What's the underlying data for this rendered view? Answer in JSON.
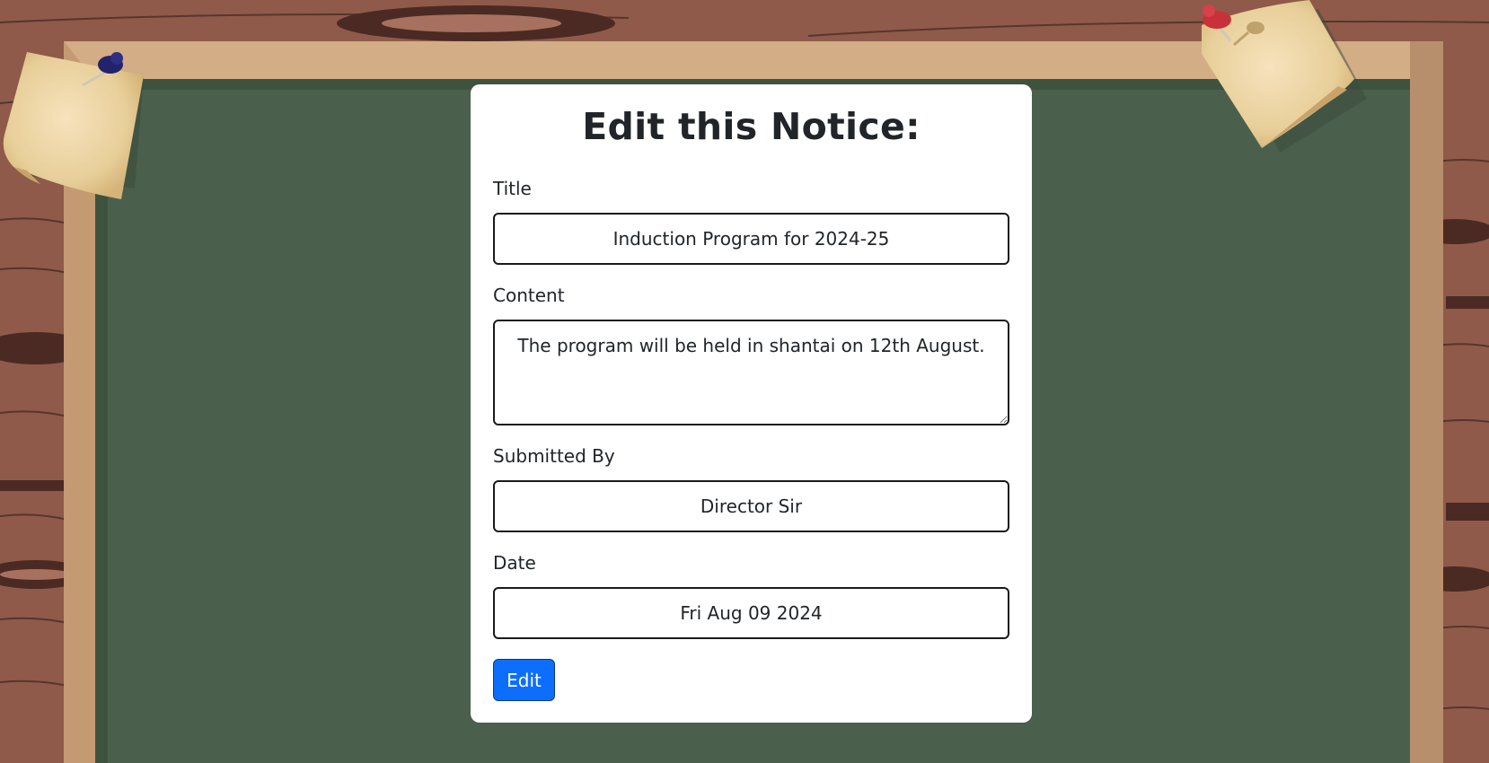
{
  "form": {
    "heading": "Edit this Notice:",
    "title_label": "Title",
    "title_value": "Induction Program for 2024-25",
    "content_label": "Content",
    "content_value": "The program will be held in shantai on 12th August.",
    "submitted_by_label": "Submitted By",
    "submitted_by_value": "Director Sir",
    "date_label": "Date",
    "date_value": "Fri Aug 09 2024",
    "submit_label": "Edit"
  },
  "colors": {
    "wood": "#8f5a4a",
    "frame": "#d2ad85",
    "board": "#4a604c",
    "button": "#0d6efd",
    "note": "#e8cf9a",
    "pin_left": "#23236b",
    "pin_right": "#c8313a"
  },
  "decorations": {
    "left_pin_icon": "pushpin-icon",
    "right_pin_icon": "pushpin-icon",
    "sticky_note_icon": "sticky-note-icon"
  }
}
